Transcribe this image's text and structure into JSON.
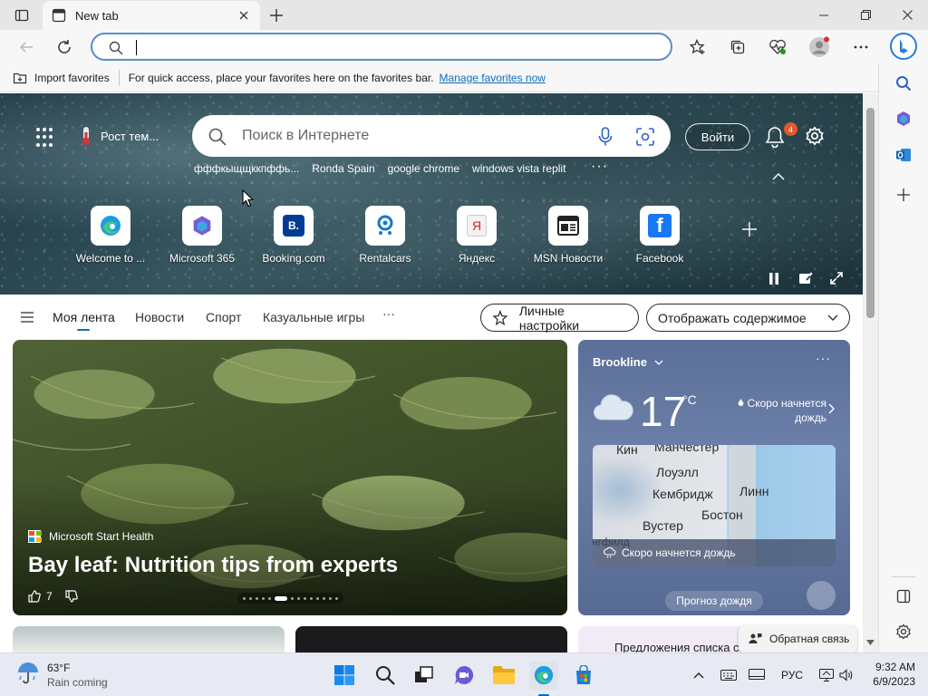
{
  "browser": {
    "tab_title": "New tab",
    "address_placeholder": "",
    "favorites_bar": {
      "import_label": "Import favorites",
      "message": "For quick access, place your favorites here on the favorites bar.",
      "manage_link": "Manage favorites now"
    }
  },
  "hero": {
    "weather_chip": "Рост тем...",
    "search_placeholder": "Поиск в Интернете",
    "signin_label": "Войти",
    "notification_count": "4",
    "trending": [
      "фффкыщщккпффь...",
      "Ronda Spain",
      "google chrome",
      "windows vista replit"
    ],
    "trending_more": "···",
    "quicklinks": [
      {
        "label": "Welcome to ...",
        "icon": "edge-icon"
      },
      {
        "label": "Microsoft 365",
        "icon": "m365-icon"
      },
      {
        "label": "Booking.com",
        "icon": "booking-icon",
        "glyph": "B."
      },
      {
        "label": "Rentalcars",
        "icon": "rentalcars-icon"
      },
      {
        "label": "Яндекс",
        "icon": "yandex-icon",
        "glyph": "Я"
      },
      {
        "label": "MSN Новости",
        "icon": "msn-news-icon"
      },
      {
        "label": "Facebook",
        "icon": "facebook-icon",
        "glyph": "f"
      }
    ]
  },
  "feed_nav": {
    "items": [
      "Моя лента",
      "Новости",
      "Спорт",
      "Казуальные игры"
    ],
    "more": "···",
    "personalize": "Личные настройки",
    "display": "Отображать содержимое"
  },
  "main_card": {
    "source": "Microsoft Start Health",
    "title": "Bay leaf: Nutrition tips from experts",
    "likes": "7"
  },
  "weather_card": {
    "location": "Brookline",
    "temperature": "17",
    "unit": "°C",
    "condition_line1": "Скоро начнется",
    "condition_line2": "дождь",
    "map_labels": [
      "Кин",
      "Манчестер",
      "Лоуэлл",
      "Кембридж",
      "Линн",
      "Вустер",
      "Бостон",
      "нгфилд"
    ],
    "map_footer": "Скоро начнется дождь",
    "forecast_button": "Прогноз дождя"
  },
  "lower_card_3": "Предложения списка стопом",
  "feedback": "Обратная связь",
  "taskbar": {
    "weather_temp": "63°F",
    "weather_desc": "Rain coming",
    "language": "РУС",
    "time": "9:32 AM",
    "date": "6/9/2023"
  },
  "colors": {
    "accent": "#0f6cbd",
    "address_border": "#5a8dcf",
    "badge": "#e05a2a"
  }
}
